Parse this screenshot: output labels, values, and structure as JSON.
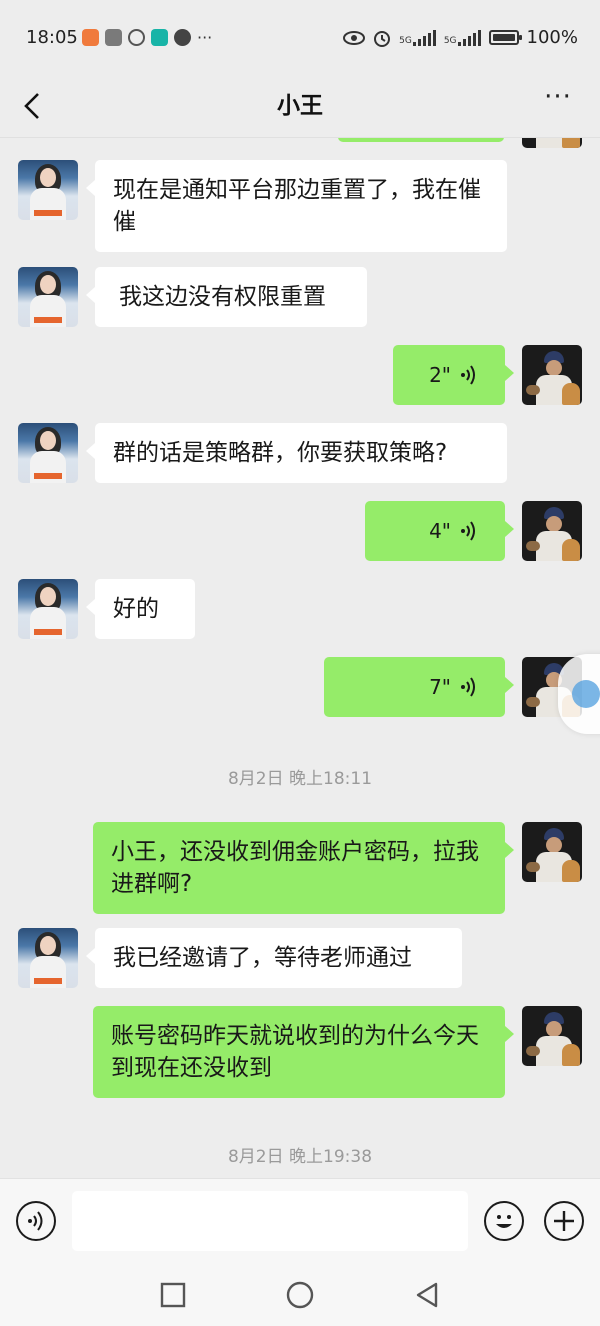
{
  "status_bar": {
    "time": "18:05",
    "signal_1": "5G",
    "signal_2": "5G",
    "battery": "100%",
    "app_icons": [
      "weibo-icon",
      "sina-icon",
      "wechat-icon",
      "boss-icon",
      "message-icon"
    ]
  },
  "header": {
    "title": "小王",
    "more_label": "···"
  },
  "messages": [
    {
      "side": "in",
      "type": "text",
      "text": "现在是通知平台那边重置了，我在催催"
    },
    {
      "side": "in",
      "type": "text",
      "text": "我这边没有权限重置"
    },
    {
      "side": "out",
      "type": "voice",
      "duration": "2\""
    },
    {
      "side": "in",
      "type": "text",
      "text": "群的话是策略群，你要获取策略?"
    },
    {
      "side": "out",
      "type": "voice",
      "duration": "4\""
    },
    {
      "side": "in",
      "type": "text",
      "text": "好的"
    },
    {
      "side": "out",
      "type": "voice",
      "duration": "7\""
    },
    {
      "type": "time",
      "text": "8月2日 晚上18:11"
    },
    {
      "side": "out",
      "type": "text",
      "text": "小王，还没收到佣金账户密码，拉我进群啊?"
    },
    {
      "side": "in",
      "type": "text",
      "text": "我已经邀请了，等待老师通过"
    },
    {
      "side": "out",
      "type": "text",
      "text": "账号密码昨天就说收到的为什么今天到现在还没收到"
    },
    {
      "type": "time",
      "text": "8月2日 晚上19:38"
    }
  ],
  "input_bar": {
    "placeholder": ""
  },
  "colors": {
    "background": "#ededed",
    "outgoing_bubble": "#95ec69",
    "incoming_bubble": "#ffffff"
  }
}
